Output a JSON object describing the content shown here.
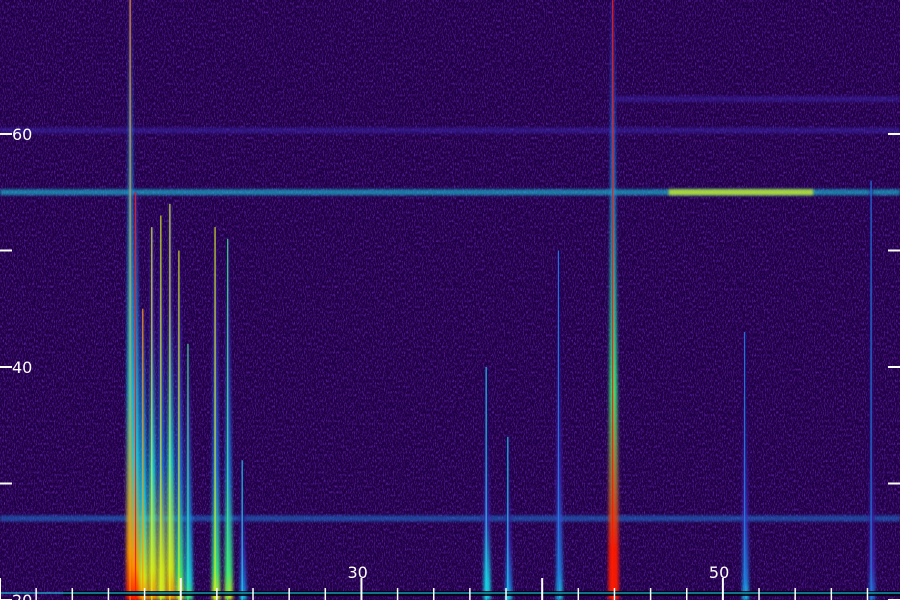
{
  "chart_data": {
    "type": "heatmap",
    "title": "",
    "xlabel": "",
    "ylabel": "",
    "xlim": [
      10,
      59.8
    ],
    "ylim": [
      20,
      71.5
    ],
    "grid": false,
    "legend": "none",
    "colormap": [
      "#1a0033",
      "#2a0a6e",
      "#3d2ab5",
      "#1f7fe0",
      "#17d6e6",
      "#3df07a",
      "#d8f21a",
      "#ff9a00",
      "#ff1a00"
    ],
    "background_color": "#200046",
    "baseline_y": 20.6,
    "x_ticks": {
      "labels": [
        "30",
        "50"
      ],
      "values": [
        30,
        50
      ],
      "label_values": [
        30,
        50
      ],
      "major": [
        10,
        20,
        30,
        40,
        50
      ],
      "minor": [
        12,
        14,
        16,
        18,
        22,
        24,
        26,
        28,
        32,
        34,
        36,
        38,
        42,
        44,
        46,
        48,
        52,
        54,
        56,
        58
      ]
    },
    "y_ticks": {
      "labels": [
        "60",
        "40",
        "20"
      ],
      "values": [
        60,
        40,
        20
      ],
      "major": [
        20,
        30,
        40,
        50,
        60
      ]
    },
    "horizontal_bands": [
      {
        "y": 55,
        "x_range": [
          10,
          59.8
        ],
        "intensity": 0.45
      },
      {
        "y": 55,
        "x_range": [
          47,
          55
        ],
        "intensity": 0.8
      },
      {
        "y": 60.3,
        "x_range": [
          10,
          59.8
        ],
        "intensity": 0.25
      },
      {
        "y": 63,
        "x_range": [
          44,
          59.8
        ],
        "intensity": 0.2
      },
      {
        "y": 27,
        "x_range": [
          10,
          59.8
        ],
        "intensity": 0.35
      }
    ],
    "series": [
      {
        "x": 17.2,
        "y_range": [
          20,
          71.5
        ],
        "intensity": 0.85
      },
      {
        "x": 17.5,
        "y_range": [
          20,
          55
        ],
        "intensity": 0.9
      },
      {
        "x": 17.9,
        "y_range": [
          20,
          45
        ],
        "intensity": 0.8
      },
      {
        "x": 18.4,
        "y_range": [
          20,
          52
        ],
        "intensity": 0.75
      },
      {
        "x": 18.9,
        "y_range": [
          20,
          53
        ],
        "intensity": 0.7
      },
      {
        "x": 19.4,
        "y_range": [
          20,
          54
        ],
        "intensity": 0.75
      },
      {
        "x": 19.9,
        "y_range": [
          20,
          50
        ],
        "intensity": 0.65
      },
      {
        "x": 20.4,
        "y_range": [
          20,
          42
        ],
        "intensity": 0.55
      },
      {
        "x": 21.9,
        "y_range": [
          20,
          52
        ],
        "intensity": 0.65
      },
      {
        "x": 22.6,
        "y_range": [
          20,
          51
        ],
        "intensity": 0.6
      },
      {
        "x": 23.4,
        "y_range": [
          20,
          32
        ],
        "intensity": 0.4
      },
      {
        "x": 36.9,
        "y_range": [
          20,
          40
        ],
        "intensity": 0.45
      },
      {
        "x": 38.1,
        "y_range": [
          20,
          34
        ],
        "intensity": 0.4
      },
      {
        "x": 40.9,
        "y_range": [
          20,
          50
        ],
        "intensity": 0.35
      },
      {
        "x": 43.9,
        "y_range": [
          20,
          71.5
        ],
        "intensity": 0.95
      },
      {
        "x": 51.2,
        "y_range": [
          20,
          43
        ],
        "intensity": 0.35
      },
      {
        "x": 58.2,
        "y_range": [
          20,
          56
        ],
        "intensity": 0.3
      }
    ]
  }
}
